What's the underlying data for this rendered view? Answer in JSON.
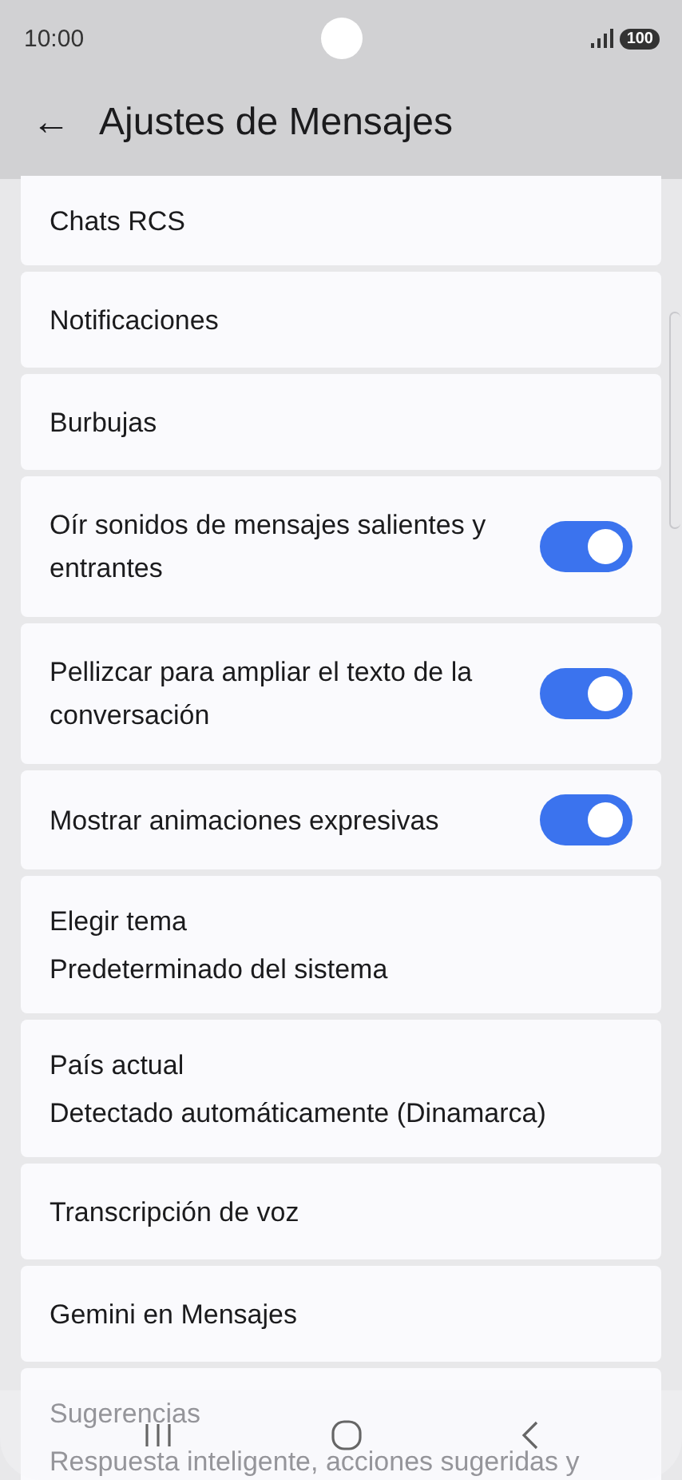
{
  "status_bar": {
    "time": "10:00",
    "battery": "100"
  },
  "header": {
    "back": "←",
    "title": "Ajustes de Mensajes"
  },
  "items": [
    {
      "kind": "link",
      "title": "Chats RCS"
    },
    {
      "kind": "link",
      "title": "Notificaciones"
    },
    {
      "kind": "link",
      "title": "Burbujas"
    },
    {
      "kind": "toggle",
      "title": "Oír sonidos de mensajes salientes y entrantes",
      "on": true
    },
    {
      "kind": "toggle",
      "title": "Pellizcar para ampliar el texto de la conversación",
      "on": true
    },
    {
      "kind": "toggle",
      "title": "Mostrar animaciones expresivas",
      "on": true
    },
    {
      "kind": "link",
      "title": "Elegir tema",
      "subtitle": "Predeterminado del sistema"
    },
    {
      "kind": "link",
      "title": "País actual",
      "subtitle": "Detectado automáticamente (Dinamarca)"
    },
    {
      "kind": "link",
      "title": "Transcripción de voz"
    },
    {
      "kind": "link",
      "title": "Gemini en Mensajes"
    },
    {
      "kind": "link",
      "title": "Sugerencias",
      "subtitle": "Respuesta inteligente, acciones sugeridas y"
    }
  ]
}
